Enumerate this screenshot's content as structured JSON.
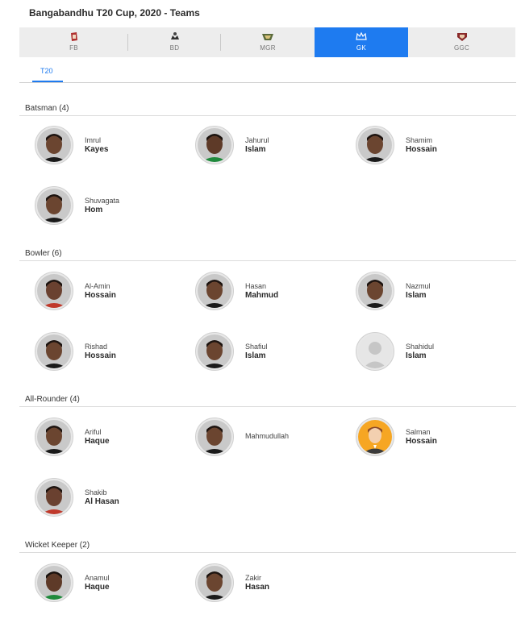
{
  "page": {
    "title": "Bangabandhu T20 Cup, 2020 - Teams"
  },
  "teams": [
    {
      "code": "FB",
      "active": false
    },
    {
      "code": "BD",
      "active": false
    },
    {
      "code": "MGR",
      "active": false
    },
    {
      "code": "GK",
      "active": true
    },
    {
      "code": "GGC",
      "active": false
    }
  ],
  "format_tab": "T20",
  "colors": {
    "accent": "#1e7bf0"
  },
  "sections": [
    {
      "title": "Batsman (4)",
      "players": [
        {
          "first": "Imrul",
          "last": "Kayes"
        },
        {
          "first": "Jahurul",
          "last": "Islam"
        },
        {
          "first": "Shamim",
          "last": "Hossain"
        },
        {
          "first": "Shuvagata",
          "last": "Hom"
        }
      ]
    },
    {
      "title": "Bowler (6)",
      "players": [
        {
          "first": "Al-Amin",
          "last": "Hossain"
        },
        {
          "first": "Hasan",
          "last": "Mahmud"
        },
        {
          "first": "Nazmul",
          "last": "Islam"
        },
        {
          "first": "Rishad",
          "last": "Hossain"
        },
        {
          "first": "Shafiul",
          "last": "Islam"
        },
        {
          "first": "Shahidul",
          "last": "Islam"
        }
      ]
    },
    {
      "title": "All-Rounder (4)",
      "players": [
        {
          "first": "Ariful",
          "last": "Haque"
        },
        {
          "first": "Mahmudullah",
          "last": ""
        },
        {
          "first": "Salman",
          "last": "Hossain"
        },
        {
          "first": "Shakib",
          "last": "Al Hasan"
        }
      ]
    },
    {
      "title": "Wicket Keeper (2)",
      "players": [
        {
          "first": "Anamul",
          "last": "Haque"
        },
        {
          "first": "Zakir",
          "last": "Hasan"
        }
      ]
    }
  ]
}
